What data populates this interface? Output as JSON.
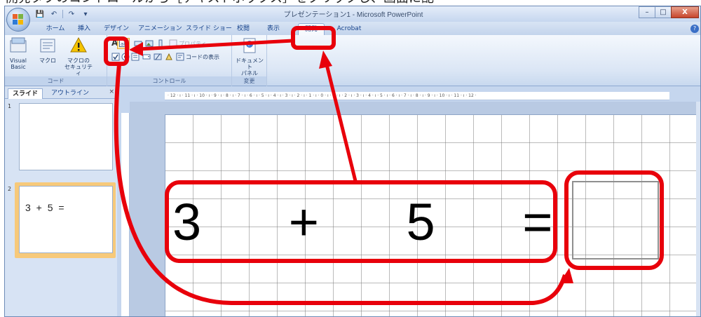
{
  "caption_top": "開発タブのコントロールから［テキストボックス］をクリックし、画面に配",
  "window": {
    "title": "プレゼンテーション1 - Microsoft PowerPoint",
    "controls": {
      "minimize": "–",
      "maximize": "□",
      "close": "X"
    },
    "help": "?"
  },
  "qat": [
    "💾",
    "↶",
    "↷",
    "▾"
  ],
  "tabs": [
    "ホーム",
    "挿入",
    "デザイン",
    "アニメーション",
    "スライド ショー",
    "校閲",
    "表示",
    "開発",
    "Acrobat"
  ],
  "active_tab": "開発",
  "ribbon": {
    "code_group": {
      "label": "コード",
      "visual_basic": "Visual\nBasic",
      "macro": "マクロ",
      "macro_security": "マクロの\nセキュリティ"
    },
    "control_group": {
      "label": "コントロール",
      "properties": "プロパティ",
      "view_code": "コードの表示"
    },
    "change_group": {
      "label": "変更",
      "document_panel": "ドキュメント\nパネル"
    }
  },
  "pane_tabs": {
    "slides": "スライド",
    "outline": "アウトライン",
    "close": "×"
  },
  "thumbnails": [
    {
      "num": "1",
      "text": ""
    },
    {
      "num": "2",
      "text": "3 + 5 ="
    }
  ],
  "ruler_h": "· 12 · ı · 11 · ı · 10 · ı · 9 · ı · 8 · ı · 7 · ı · 6 · ı · 5 · ı · 4 · ı · 3 · ı · 2 · ı · 1 · ı · 0 · ı · 1 · ı · 2 · ı · 3 · ı · 4 · ı · 5 · ı · 6 · ı · 7 · ı · 8 · ı · 9 · ı · 10 · ı · 11 · ı · 12 ·",
  "slide": {
    "equation": "3 + 5 ="
  },
  "colors": {
    "annotation": "#e8000b",
    "accent": "#15428b",
    "selected_thumb": "#f7c97a"
  }
}
